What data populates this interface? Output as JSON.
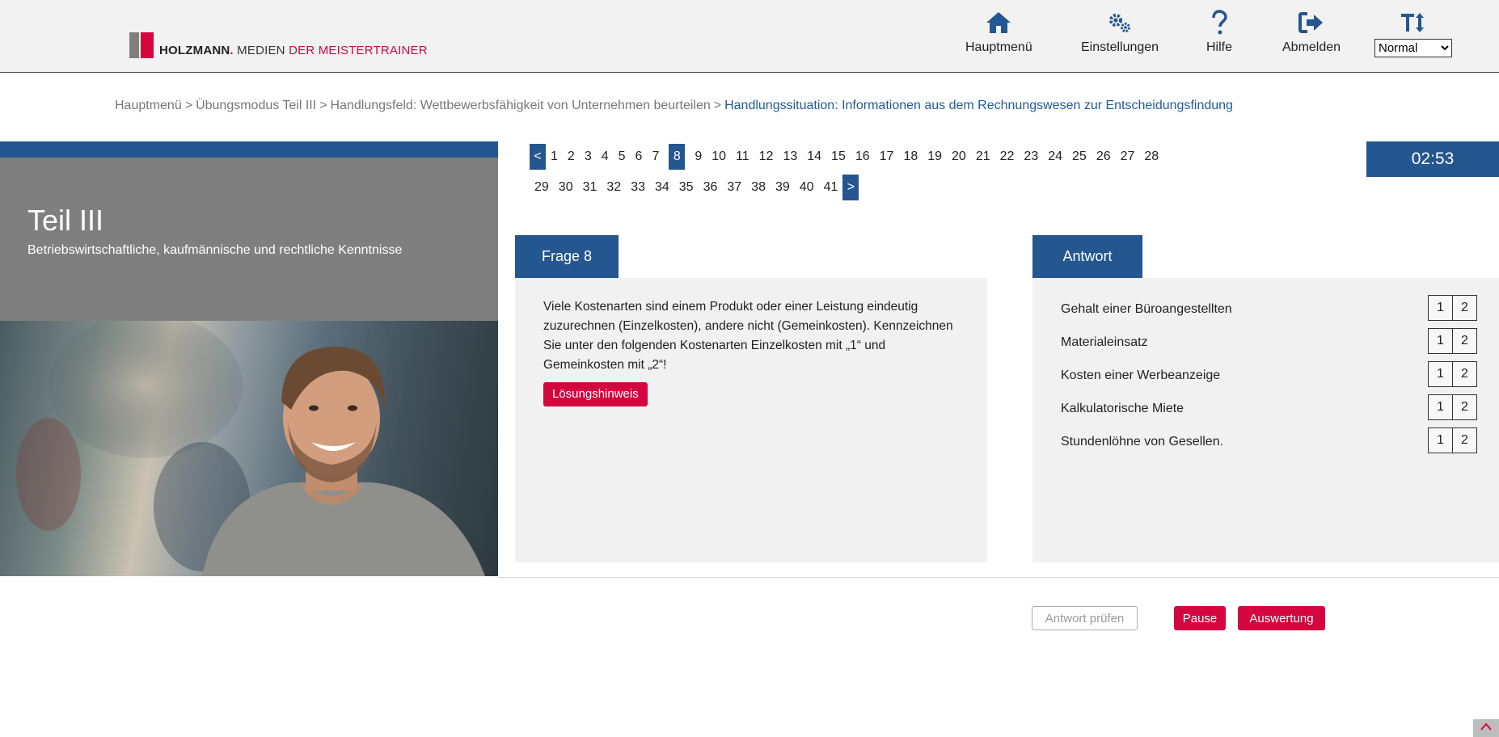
{
  "brand": {
    "name_bold": "HOLZMANN",
    "name_dot": ".",
    "name_media": " MEDIEN ",
    "tagline": "DER MEISTERTRAINER",
    "colors": {
      "accent_red": "#d4063f",
      "primary_blue": "#24568f",
      "logo_grey": "#7f7f7f"
    }
  },
  "nav": {
    "home": {
      "label": "Hauptmenü",
      "icon": "home-icon"
    },
    "settings": {
      "label": "Einstellungen",
      "icon": "gears-icon"
    },
    "help": {
      "label": "Hilfe",
      "icon": "question-icon"
    },
    "logout": {
      "label": "Abmelden",
      "icon": "logout-icon"
    },
    "font_size": {
      "icon": "text-height-icon",
      "selected": "Normal"
    }
  },
  "breadcrumb": {
    "items": [
      "Hauptmenü",
      "Übungsmodus Teil III",
      "Handlungsfeld: Wettbewerbsfähigkeit von Unternehmen beurteilen"
    ],
    "separator": ">",
    "current": "Handlungssituation: Informationen aus dem Rechnungswesen zur Entscheidungsfindung"
  },
  "part": {
    "title": "Teil III",
    "subtitle": "Betriebswirtschaftliche, kaufmännische und rechtliche Kenntnisse"
  },
  "pagination": {
    "prev": "<",
    "next": ">",
    "row1": [
      "1",
      "2",
      "3",
      "4",
      "5",
      "6",
      "7",
      "8",
      "9",
      "10",
      "11",
      "12",
      "13",
      "14",
      "15",
      "16",
      "17",
      "18",
      "19",
      "20",
      "21",
      "22",
      "23",
      "24",
      "25",
      "26",
      "27",
      "28"
    ],
    "row2": [
      "29",
      "30",
      "31",
      "32",
      "33",
      "34",
      "35",
      "36",
      "37",
      "38",
      "39",
      "40",
      "41"
    ],
    "active": "8"
  },
  "timer": "02:53",
  "question": {
    "tab": "Frage 8",
    "text": "Viele Kostenarten sind einem Produkt oder einer Leistung eindeutig zuzurechnen (Einzelkosten), andere nicht (Gemeinkosten). Kennzeichnen Sie unter den folgenden Kostenarten Einzelkosten mit „1“ und Gemeinkosten mit „2“!",
    "hint_button": "Lösungshinweis"
  },
  "answer": {
    "tab": "Antwort",
    "items": [
      {
        "label": "Gehalt einer Büroangestellten",
        "opt1": "1",
        "opt2": "2"
      },
      {
        "label": "Materialeinsatz",
        "opt1": "1",
        "opt2": "2"
      },
      {
        "label": "Kosten einer Werbeanzeige",
        "opt1": "1",
        "opt2": "2"
      },
      {
        "label": "Kalkulatorische Miete",
        "opt1": "1",
        "opt2": "2"
      },
      {
        "label": "Stundenlöhne von Gesellen.",
        "opt1": "1",
        "opt2": "2"
      }
    ]
  },
  "actions": {
    "check": "Antwort prüfen",
    "pause": "Pause",
    "evaluate": "Auswertung"
  },
  "scroll_top_icon": "arrow-up-icon"
}
